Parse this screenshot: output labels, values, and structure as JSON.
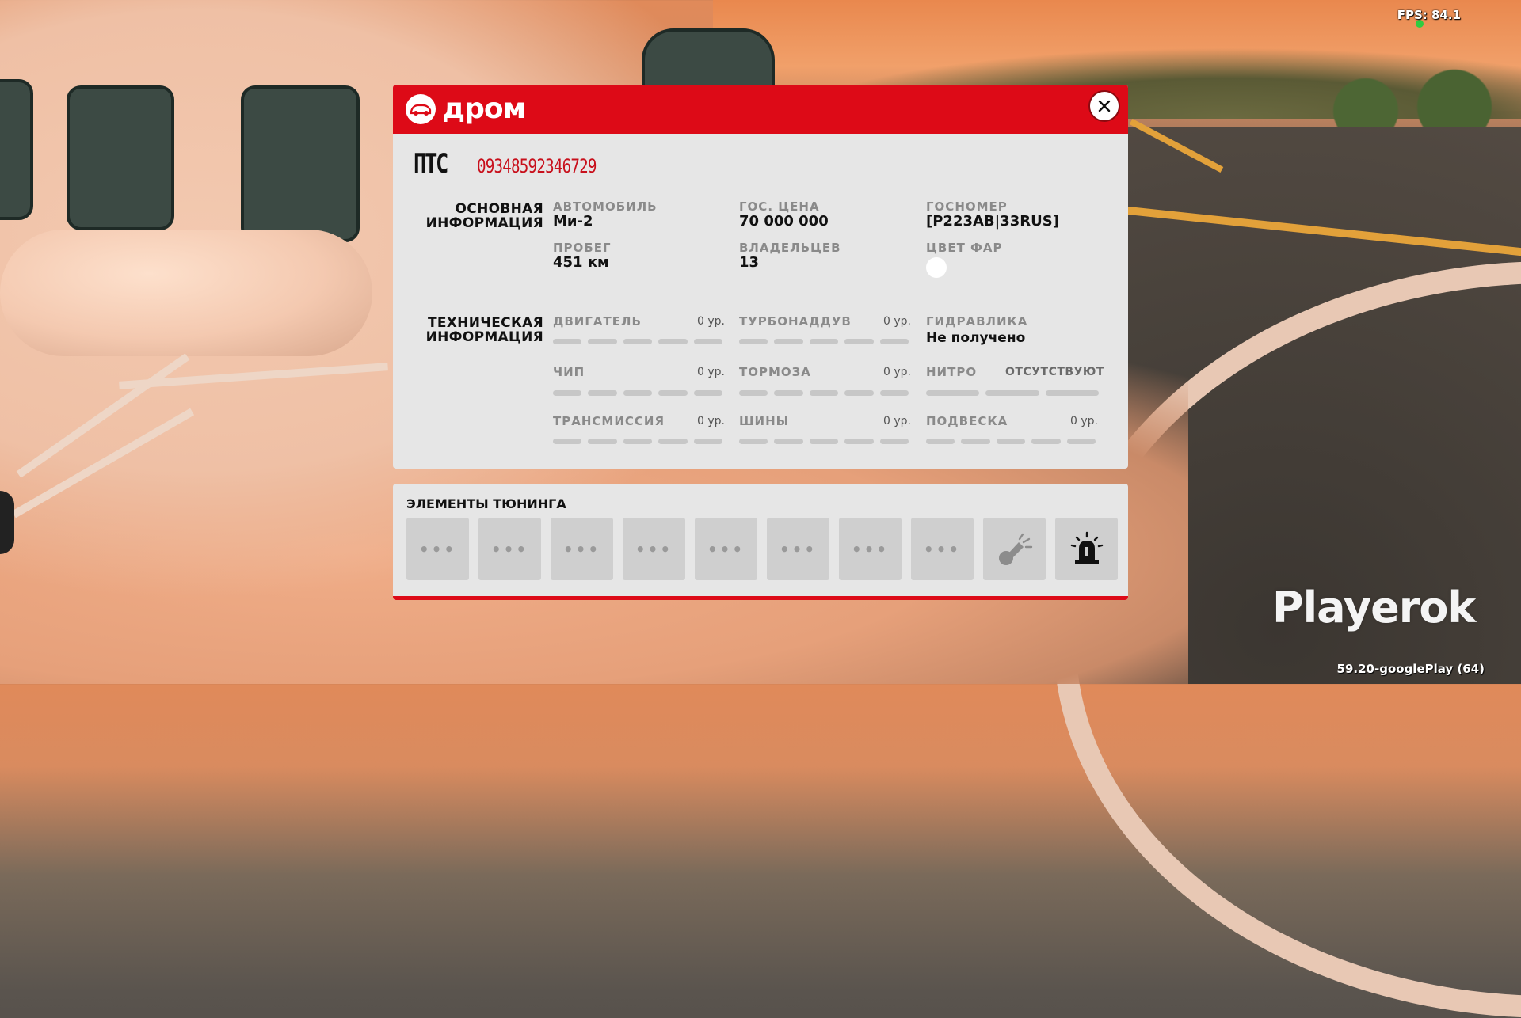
{
  "hud": {
    "fps": "FPS: 84.1",
    "build": "59.20-googlePlay (64)",
    "watermark": "Playerok"
  },
  "header": {
    "brand": "дром"
  },
  "pts": {
    "label": "ПТС",
    "number": "09348592346729"
  },
  "main_info": {
    "title_line1": "ОСНОВНАЯ",
    "title_line2": "ИНФОРМАЦИЯ",
    "car_label": "АВТОМОБИЛЬ",
    "car_value": "Ми-2",
    "price_label": "ГОС. ЦЕНА",
    "price_value": "70 000 000",
    "plate_label": "ГОСНОМЕР",
    "plate_value": "[Р223АВ|33RUS]",
    "mileage_label": "ПРОБЕГ",
    "mileage_value": "451 км",
    "owners_label": "ВЛАДЕЛЬЦЕВ",
    "owners_value": "13",
    "headlight_label": "ЦВЕТ ФАР",
    "headlight_color": "#ffffff"
  },
  "tech_info": {
    "title_line1": "ТЕХНИЧЕСКАЯ",
    "title_line2": "ИНФОРМАЦИЯ",
    "engine_label": "ДВИГАТЕЛЬ",
    "engine_level": "0 ур.",
    "turbo_label": "ТУРБОНАДДУВ",
    "turbo_level": "0 ур.",
    "hydraulics_label": "ГИДРАВЛИКА",
    "hydraulics_value": "Не получено",
    "chip_label": "ЧИП",
    "chip_level": "0 ур.",
    "brakes_label": "ТОРМОЗА",
    "brakes_level": "0 ур.",
    "nitro_label": "НИТРО",
    "nitro_value": "ОТСУТСТВУЮТ",
    "transmission_label": "ТРАНСМИССИЯ",
    "transmission_level": "0 ур.",
    "tires_label": "ШИНЫ",
    "tires_level": "0 ур.",
    "suspension_label": "ПОДВЕСКА",
    "suspension_level": "0 ур."
  },
  "tuning": {
    "title": "ЭЛЕМЕНТЫ ТЮНИНГА",
    "empty_slot": "•••",
    "special_slots": [
      "horn-icon",
      "siren-icon"
    ]
  },
  "colors": {
    "accent": "#dd0a17",
    "card_bg": "#e6e6e6",
    "pts_number": "#c8101c"
  }
}
